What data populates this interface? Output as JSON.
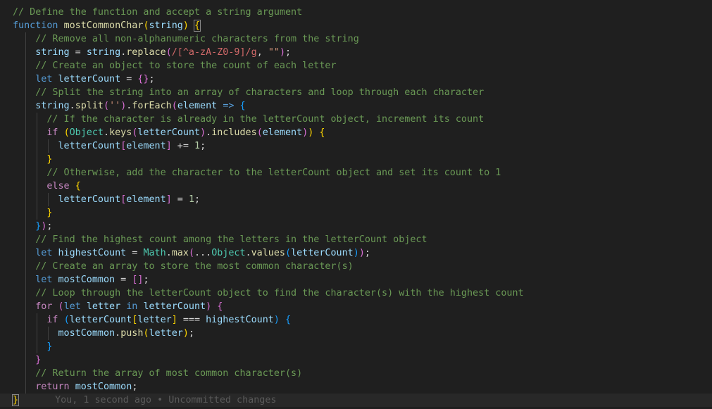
{
  "editor": {
    "language": "javascript",
    "theme_colors": {
      "background": "#1f1f1f",
      "comment": "#6a9955",
      "keyword": "#569cd6",
      "control": "#c586c0",
      "function": "#dcdcaa",
      "variable": "#9cdcfe",
      "object": "#4ec9b0",
      "string": "#ce9178",
      "regex": "#d16969",
      "number": "#b5cea8",
      "bracket_level1": "#ffd700",
      "bracket_level2": "#da70d6",
      "bracket_level3": "#179fff",
      "blame": "#5a5a5a"
    },
    "blame_annotation": "You, 1 second ago • Uncommitted changes",
    "lines": [
      {
        "indent": 0,
        "tokens": [
          [
            "c",
            "// Define the function and accept a string argument"
          ]
        ]
      },
      {
        "indent": 0,
        "tokens": [
          [
            "k",
            "function "
          ],
          [
            "f",
            "mostCommonChar"
          ],
          [
            "b1",
            "("
          ],
          [
            "v",
            "string"
          ],
          [
            "b1",
            ")"
          ],
          [
            "o",
            " "
          ],
          [
            "b1m",
            "{"
          ]
        ]
      },
      {
        "indent": 4,
        "tokens": [
          [
            "c",
            "// Remove all non-alphanumeric characters from the string"
          ]
        ]
      },
      {
        "indent": 4,
        "tokens": [
          [
            "v",
            "string"
          ],
          [
            "o",
            " = "
          ],
          [
            "v",
            "string"
          ],
          [
            "o",
            "."
          ],
          [
            "f",
            "replace"
          ],
          [
            "b2",
            "("
          ],
          [
            "r",
            "/[^a-zA-Z0-9]/g"
          ],
          [
            "o",
            ", "
          ],
          [
            "s",
            "\"\""
          ],
          [
            "b2",
            ")"
          ],
          [
            "o",
            ";"
          ]
        ]
      },
      {
        "indent": 4,
        "tokens": [
          [
            "c",
            "// Create an object to store the count of each letter"
          ]
        ]
      },
      {
        "indent": 4,
        "tokens": [
          [
            "k",
            "let "
          ],
          [
            "v",
            "letterCount"
          ],
          [
            "o",
            " = "
          ],
          [
            "b2",
            "{}"
          ],
          [
            "o",
            ";"
          ]
        ]
      },
      {
        "indent": 4,
        "tokens": [
          [
            "c",
            "// Split the string into an array of characters and loop through each character"
          ]
        ]
      },
      {
        "indent": 4,
        "tokens": [
          [
            "v",
            "string"
          ],
          [
            "o",
            "."
          ],
          [
            "f",
            "split"
          ],
          [
            "b2",
            "("
          ],
          [
            "s",
            "''"
          ],
          [
            "b2",
            ")"
          ],
          [
            "o",
            "."
          ],
          [
            "f",
            "forEach"
          ],
          [
            "b2",
            "("
          ],
          [
            "v",
            "element"
          ],
          [
            "o",
            " "
          ],
          [
            "k",
            "=>"
          ],
          [
            "o",
            " "
          ],
          [
            "b3",
            "{"
          ]
        ]
      },
      {
        "indent": 6,
        "tokens": [
          [
            "c",
            "// If the character is already in the letterCount object, increment its count"
          ]
        ]
      },
      {
        "indent": 6,
        "tokens": [
          [
            "x",
            "if "
          ],
          [
            "b1",
            "("
          ],
          [
            "t",
            "Object"
          ],
          [
            "o",
            "."
          ],
          [
            "f",
            "keys"
          ],
          [
            "b2",
            "("
          ],
          [
            "v",
            "letterCount"
          ],
          [
            "b2",
            ")"
          ],
          [
            "o",
            "."
          ],
          [
            "f",
            "includes"
          ],
          [
            "b2",
            "("
          ],
          [
            "v",
            "element"
          ],
          [
            "b2",
            ")"
          ],
          [
            "b1",
            ")"
          ],
          [
            "o",
            " "
          ],
          [
            "b1",
            "{"
          ]
        ]
      },
      {
        "indent": 8,
        "tokens": [
          [
            "v",
            "letterCount"
          ],
          [
            "b2",
            "["
          ],
          [
            "v",
            "element"
          ],
          [
            "b2",
            "]"
          ],
          [
            "o",
            " += "
          ],
          [
            "n",
            "1"
          ],
          [
            "o",
            ";"
          ]
        ]
      },
      {
        "indent": 6,
        "tokens": [
          [
            "b1",
            "}"
          ]
        ]
      },
      {
        "indent": 6,
        "tokens": [
          [
            "c",
            "// Otherwise, add the character to the letterCount object and set its count to 1"
          ]
        ]
      },
      {
        "indent": 6,
        "tokens": [
          [
            "x",
            "else "
          ],
          [
            "b1",
            "{"
          ]
        ]
      },
      {
        "indent": 8,
        "tokens": [
          [
            "v",
            "letterCount"
          ],
          [
            "b2",
            "["
          ],
          [
            "v",
            "element"
          ],
          [
            "b2",
            "]"
          ],
          [
            "o",
            " = "
          ],
          [
            "n",
            "1"
          ],
          [
            "o",
            ";"
          ]
        ]
      },
      {
        "indent": 6,
        "tokens": [
          [
            "b1",
            "}"
          ]
        ]
      },
      {
        "indent": 4,
        "tokens": [
          [
            "b3",
            "}"
          ],
          [
            "b2",
            ")"
          ],
          [
            "o",
            ";"
          ]
        ]
      },
      {
        "indent": 4,
        "tokens": [
          [
            "c",
            "// Find the highest count among the letters in the letterCount object"
          ]
        ]
      },
      {
        "indent": 4,
        "tokens": [
          [
            "k",
            "let "
          ],
          [
            "v",
            "highestCount"
          ],
          [
            "o",
            " = "
          ],
          [
            "t",
            "Math"
          ],
          [
            "o",
            "."
          ],
          [
            "f",
            "max"
          ],
          [
            "b2",
            "("
          ],
          [
            "o",
            "..."
          ],
          [
            "t",
            "Object"
          ],
          [
            "o",
            "."
          ],
          [
            "f",
            "values"
          ],
          [
            "b3",
            "("
          ],
          [
            "v",
            "letterCount"
          ],
          [
            "b3",
            ")"
          ],
          [
            "b2",
            ")"
          ],
          [
            "o",
            ";"
          ]
        ]
      },
      {
        "indent": 4,
        "tokens": [
          [
            "c",
            "// Create an array to store the most common character(s)"
          ]
        ]
      },
      {
        "indent": 4,
        "tokens": [
          [
            "k",
            "let "
          ],
          [
            "v",
            "mostCommon"
          ],
          [
            "o",
            " = "
          ],
          [
            "b2",
            "[]"
          ],
          [
            "o",
            ";"
          ]
        ]
      },
      {
        "indent": 4,
        "tokens": [
          [
            "c",
            "// Loop through the letterCount object to find the character(s) with the highest count"
          ]
        ]
      },
      {
        "indent": 4,
        "tokens": [
          [
            "x",
            "for "
          ],
          [
            "b2",
            "("
          ],
          [
            "k",
            "let "
          ],
          [
            "v",
            "letter"
          ],
          [
            "o",
            " "
          ],
          [
            "k",
            "in"
          ],
          [
            "o",
            " "
          ],
          [
            "v",
            "letterCount"
          ],
          [
            "b2",
            ")"
          ],
          [
            "o",
            " "
          ],
          [
            "b2",
            "{"
          ]
        ]
      },
      {
        "indent": 6,
        "tokens": [
          [
            "x",
            "if "
          ],
          [
            "b3",
            "("
          ],
          [
            "v",
            "letterCount"
          ],
          [
            "b1",
            "["
          ],
          [
            "v",
            "letter"
          ],
          [
            "b1",
            "]"
          ],
          [
            "o",
            " === "
          ],
          [
            "v",
            "highestCount"
          ],
          [
            "b3",
            ")"
          ],
          [
            "o",
            " "
          ],
          [
            "b3",
            "{"
          ]
        ]
      },
      {
        "indent": 8,
        "tokens": [
          [
            "v",
            "mostCommon"
          ],
          [
            "o",
            "."
          ],
          [
            "f",
            "push"
          ],
          [
            "b1",
            "("
          ],
          [
            "v",
            "letter"
          ],
          [
            "b1",
            ")"
          ],
          [
            "o",
            ";"
          ]
        ]
      },
      {
        "indent": 6,
        "tokens": [
          [
            "b3",
            "}"
          ]
        ]
      },
      {
        "indent": 4,
        "tokens": [
          [
            "b2",
            "}"
          ]
        ]
      },
      {
        "indent": 4,
        "tokens": [
          [
            "c",
            "// Return the array of most common character(s)"
          ]
        ]
      },
      {
        "indent": 4,
        "tokens": [
          [
            "x",
            "return "
          ],
          [
            "v",
            "mostCommon"
          ],
          [
            "o",
            ";"
          ]
        ]
      },
      {
        "indent": 0,
        "tokens": [
          [
            "b1m",
            "}"
          ]
        ],
        "blame": true
      }
    ]
  }
}
